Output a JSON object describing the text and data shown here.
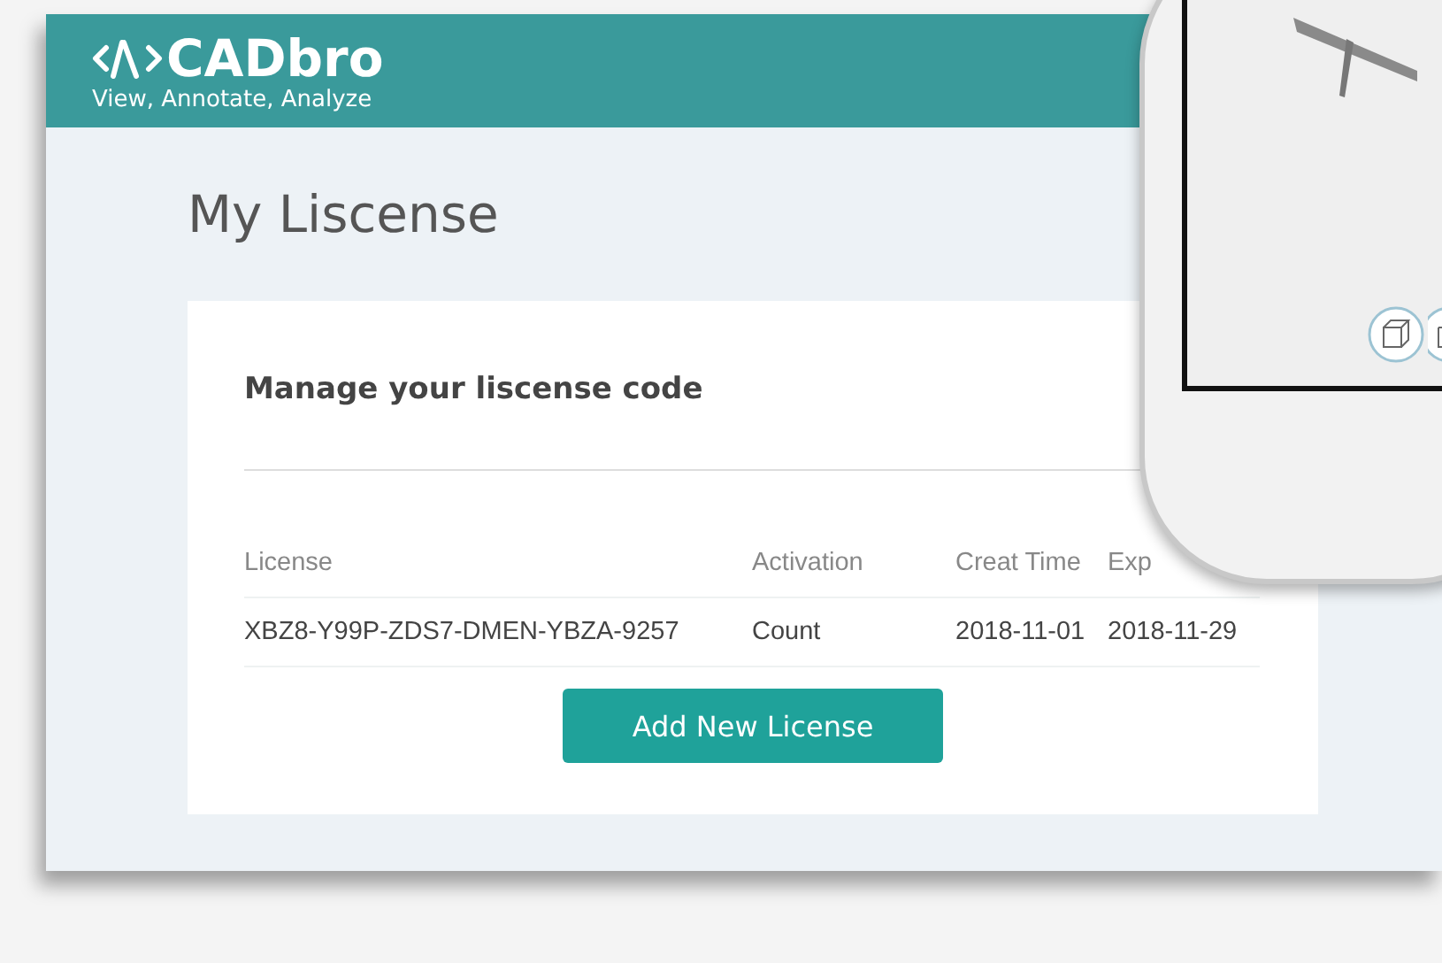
{
  "header": {
    "logo": "CADbro",
    "tagline": "View, Annotate, Analyze"
  },
  "page_title": "My Liscense",
  "card": {
    "heading": "Manage your liscense code",
    "table": {
      "columns": [
        "License",
        "Activation",
        "Creat Time",
        "Exp"
      ],
      "rows": [
        [
          "XBZ8-Y99P-ZDS7-DMEN-YBZA-9257",
          "Count",
          "2018-11-01",
          "2018-11-29"
        ]
      ]
    },
    "button": "Add New License"
  }
}
